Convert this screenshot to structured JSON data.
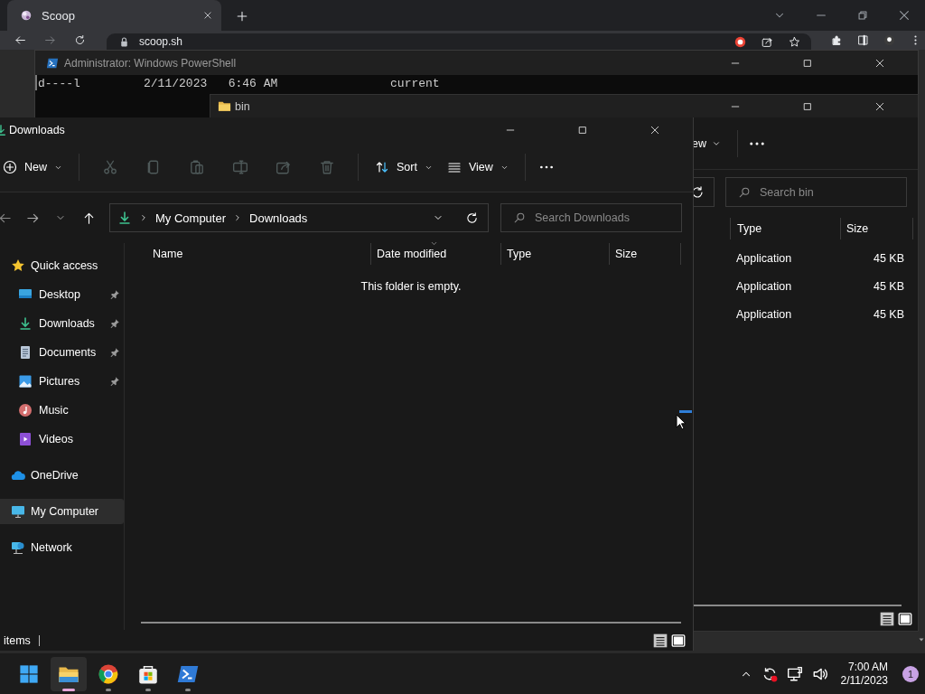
{
  "browser": {
    "tabs": [
      {
        "title": "Scoop",
        "selected": true
      }
    ],
    "address": "scoop.sh"
  },
  "terminal": {
    "title": "Administrator: Windows PowerShell",
    "lines": [
      "d----l         2/11/2023   6:46 AM                current"
    ]
  },
  "bin_window": {
    "title": "bin",
    "toolbar": [
      {
        "kind": "menu",
        "label": "ew"
      },
      {
        "kind": "separator"
      },
      {
        "kind": "more"
      }
    ],
    "search": {
      "placeholder": "Search bin"
    },
    "columns": [
      "Type",
      "Size"
    ],
    "rows": [
      {
        "type": "Application",
        "size": "45 KB"
      },
      {
        "type": "Application",
        "size": "45 KB"
      },
      {
        "type": "Application",
        "size": "45 KB"
      }
    ]
  },
  "explorer": {
    "title": "Downloads",
    "toolbar": [
      {
        "kind": "menu",
        "label": "New",
        "disabled": false
      },
      {
        "kind": "separator"
      },
      {
        "kind": "icon",
        "disabled": true
      },
      {
        "kind": "icon",
        "disabled": true
      },
      {
        "kind": "icon",
        "disabled": true
      },
      {
        "kind": "icon",
        "disabled": true
      },
      {
        "kind": "icon",
        "disabled": true
      },
      {
        "kind": "icon",
        "disabled": true
      },
      {
        "kind": "separator"
      },
      {
        "kind": "menu",
        "label": "Sort",
        "disabled": false
      },
      {
        "kind": "menu",
        "label": "View",
        "disabled": false
      },
      {
        "kind": "separator"
      },
      {
        "kind": "more"
      }
    ],
    "address": {
      "crumbs": [
        "My Computer",
        "Downloads"
      ]
    },
    "search": {
      "placeholder": "Search Downloads"
    },
    "sidebar": [
      {
        "label": "Quick access",
        "selected": false,
        "children": [
          {
            "label": "Desktop",
            "pinned": true,
            "selected": false
          },
          {
            "label": "Downloads",
            "pinned": true,
            "selected": false
          },
          {
            "label": "Documents",
            "pinned": true,
            "selected": false
          },
          {
            "label": "Pictures",
            "pinned": true,
            "selected": false
          },
          {
            "label": "Music",
            "pinned": false,
            "selected": false
          },
          {
            "label": "Videos",
            "pinned": false,
            "selected": false
          }
        ]
      },
      {
        "label": "OneDrive",
        "selected": false
      },
      {
        "label": "My Computer",
        "selected": true
      },
      {
        "label": "Network",
        "selected": false
      }
    ],
    "columns": [
      "Name",
      "Date modified",
      "Type",
      "Size"
    ],
    "empty_message": "This folder is empty.",
    "status": "items"
  },
  "taskbar": {
    "apps": [
      {
        "selected": true
      },
      {
        "selected": false
      },
      {
        "selected": false
      },
      {
        "selected": false
      }
    ],
    "time": "7:00 AM",
    "date": "2/11/2023",
    "notification_count": "1"
  }
}
